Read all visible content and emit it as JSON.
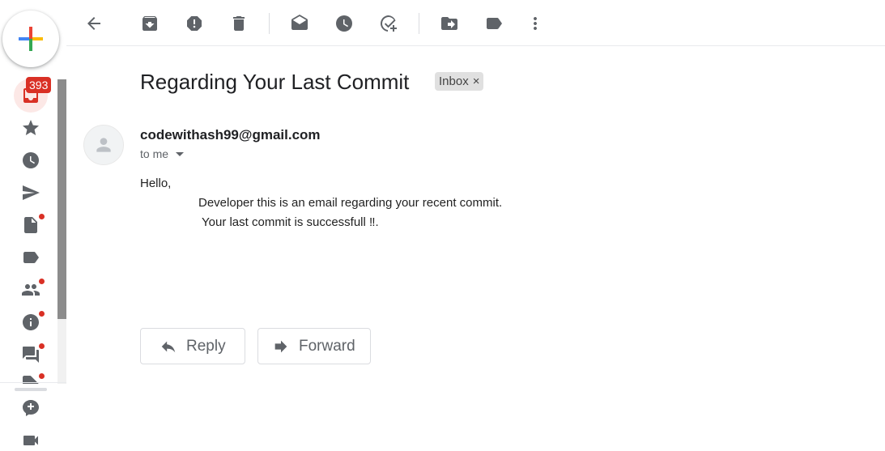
{
  "sidebar": {
    "unread_count": "393",
    "items": [
      {
        "name": "inbox-icon"
      },
      {
        "name": "star-icon"
      },
      {
        "name": "clock-icon"
      },
      {
        "name": "send-icon"
      },
      {
        "name": "draft-icon"
      },
      {
        "name": "label-icon"
      },
      {
        "name": "people-icon"
      },
      {
        "name": "info-icon"
      },
      {
        "name": "forum-icon"
      },
      {
        "name": "tag-icon"
      },
      {
        "name": "chat-icon"
      },
      {
        "name": "video-icon"
      }
    ]
  },
  "toolbar": {
    "buttons": [
      "back-icon",
      "archive-icon",
      "report-spam-icon",
      "delete-icon",
      "mark-unread-icon",
      "snooze-icon",
      "add-task-icon",
      "move-to-icon",
      "labels-icon",
      "more-icon"
    ]
  },
  "email": {
    "subject": "Regarding Your Last Commit",
    "label": "Inbox",
    "label_close": "×",
    "sender": "codewithash99@gmail.com",
    "recipient": "to me",
    "greeting": "Hello,",
    "line1": "Developer this is an email regarding your recent commit.",
    "line2": "Your last commit is successfull ‼."
  },
  "actions": {
    "reply_label": "Reply",
    "forward_label": "Forward"
  },
  "colors": {
    "accent_red": "#d93025",
    "icon_gray": "#5f6368"
  }
}
